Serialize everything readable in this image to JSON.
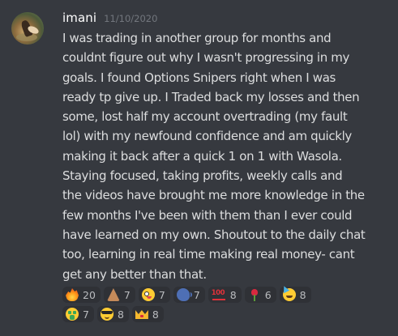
{
  "message": {
    "username": "imani",
    "timestamp": "11/10/2020",
    "lines": [
      "I was trading in another group for months and",
      "couldnt figure out why I wasn't progressing in my",
      "goals. I found Options Snipers right when I was",
      "ready tp give up. I Traded back my losses and then",
      "some, lost half my account overtrading (my fault",
      "lol) with my newfound confidence and am quickly",
      "making it back after a quick 1 on 1 with Wasola.",
      "Staying focused, taking profits, weekly calls and",
      "the videos have brought me more knowledge in the",
      "few months I've been with them than I ever could",
      "have learned on my own. Shoutout to the daily chat",
      "too, learning in real time making real money- cant",
      "get any better than that."
    ]
  },
  "reactions": {
    "row1": [
      {
        "icon": "fire-emoji",
        "count": "20"
      },
      {
        "icon": "folded-hands-emoji",
        "count": "7"
      },
      {
        "icon": "zany-face-emoji",
        "count": "7"
      },
      {
        "icon": "speaking-head-emoji",
        "count": "7"
      },
      {
        "icon": "hundred-points-emoji",
        "count": "8"
      },
      {
        "icon": "rose-emoji",
        "count": "6"
      },
      {
        "icon": "partying-face-emoji",
        "count": "8"
      }
    ],
    "row2": [
      {
        "icon": "money-mouth-face-emoji",
        "count": "7"
      },
      {
        "icon": "sunglasses-face-emoji",
        "count": "8"
      },
      {
        "icon": "crown-emoji",
        "count": "8"
      }
    ]
  },
  "colors": {
    "background": "#36393f",
    "username": "#ffffff",
    "timestamp": "#72767d",
    "text": "#dcddde",
    "reaction_bg": "#2f3136",
    "reaction_count": "#b9bbbe"
  }
}
